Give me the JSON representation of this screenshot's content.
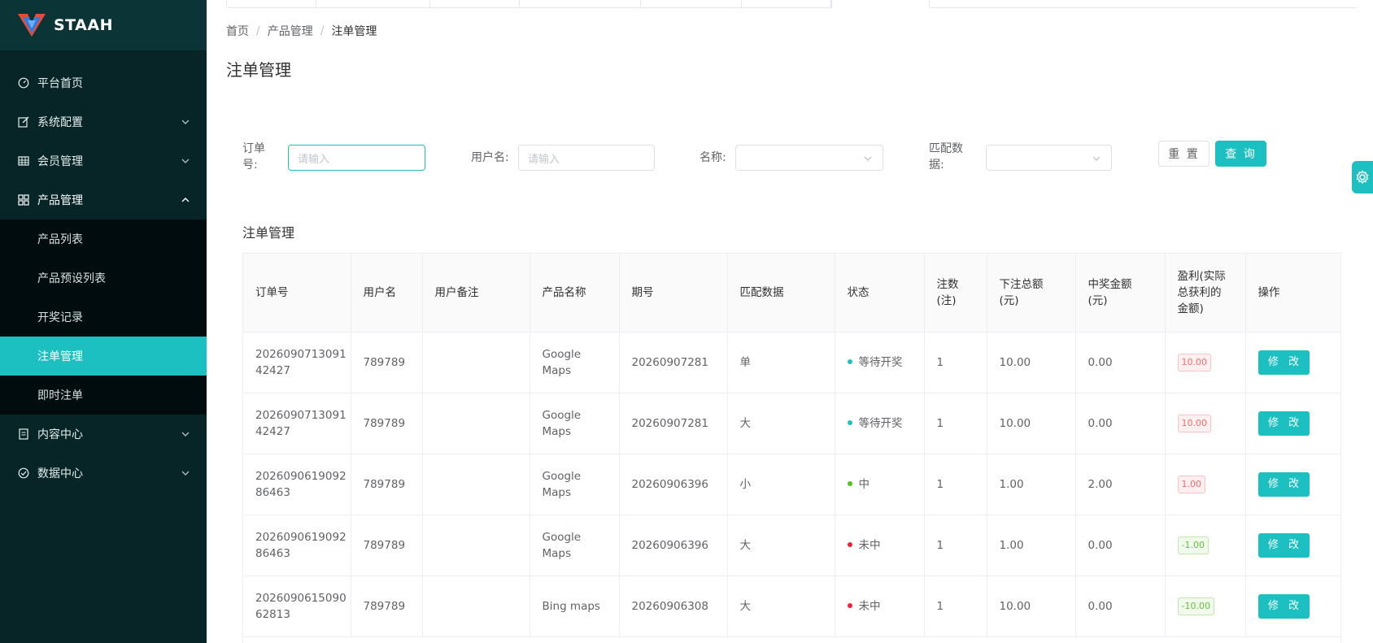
{
  "app": {
    "logo_text": "STAAH"
  },
  "sidebar": {
    "items": [
      {
        "label": "平台首页",
        "icon": "dashboard-icon"
      },
      {
        "label": "系统配置",
        "icon": "edit-icon"
      },
      {
        "label": "会员管理",
        "icon": "table-icon"
      },
      {
        "label": "产品管理",
        "icon": "grid-icon"
      },
      {
        "label": "内容中心",
        "icon": "document-icon"
      },
      {
        "label": "数据中心",
        "icon": "check-circle-icon"
      }
    ],
    "sub_items": [
      "产品列表",
      "产品预设列表",
      "开奖记录",
      "注单管理",
      "即时注单"
    ]
  },
  "breadcrumb": {
    "home": "首页",
    "level1": "产品管理",
    "current": "注单管理"
  },
  "page": {
    "title": "注单管理",
    "section_title": "注单管理"
  },
  "filters": {
    "order_label": "订单号:",
    "order_label_l1": "订单",
    "order_label_l2": "号:",
    "order_placeholder": "请输入",
    "username_label": "用户名:",
    "username_placeholder": "请输入",
    "name_label": "名称:",
    "match_label_l1": "匹配数",
    "match_label_l2": "据:",
    "reset_label": "重 置",
    "query_label": "查 询"
  },
  "table": {
    "headers": [
      [
        "订单号"
      ],
      [
        "用户名"
      ],
      [
        "用户备注"
      ],
      [
        "产品名称"
      ],
      [
        "期号"
      ],
      [
        "匹配数据"
      ],
      [
        "状态"
      ],
      [
        "注数",
        "(注)"
      ],
      [
        "下注总额",
        "(元)"
      ],
      [
        "中奖金额",
        "(元)"
      ],
      [
        "盈利(实际",
        "总获利的",
        "金额)"
      ],
      [
        "操作"
      ]
    ],
    "edit_label": "修 改",
    "rows": [
      {
        "order": [
          "2026090713091",
          "42427"
        ],
        "user": "789789",
        "note": "",
        "product": [
          "Google",
          "Maps"
        ],
        "period": "20260907281",
        "match": "单",
        "status": "等待开奖",
        "status_color": "#1cc0c0",
        "count": "1",
        "total": "10.00",
        "win": "0.00",
        "profit": "10.00",
        "profit_type": "red"
      },
      {
        "order": [
          "2026090713091",
          "42427"
        ],
        "user": "789789",
        "note": "",
        "product": [
          "Google",
          "Maps"
        ],
        "period": "20260907281",
        "match": "大",
        "status": "等待开奖",
        "status_color": "#1cc0c0",
        "count": "1",
        "total": "10.00",
        "win": "0.00",
        "profit": "10.00",
        "profit_type": "red"
      },
      {
        "order": [
          "2026090619092",
          "86463"
        ],
        "user": "789789",
        "note": "",
        "product": [
          "Google",
          "Maps"
        ],
        "period": "20260906396",
        "match": "小",
        "status": "中",
        "status_color": "#52c41a",
        "count": "1",
        "total": "1.00",
        "win": "2.00",
        "profit": "1.00",
        "profit_type": "red"
      },
      {
        "order": [
          "2026090619092",
          "86463"
        ],
        "user": "789789",
        "note": "",
        "product": [
          "Google",
          "Maps"
        ],
        "period": "20260906396",
        "match": "大",
        "status": "未中",
        "status_color": "#f5222d",
        "count": "1",
        "total": "1.00",
        "win": "0.00",
        "profit": "-1.00",
        "profit_type": "green"
      },
      {
        "order": [
          "2026090615090",
          "62813"
        ],
        "user": "789789",
        "note": "",
        "product": [
          "Bing maps"
        ],
        "period": "20260906308",
        "match": "大",
        "status": "未中",
        "status_color": "#f5222d",
        "count": "1",
        "total": "10.00",
        "win": "0.00",
        "profit": "-10.00",
        "profit_type": "green"
      }
    ]
  },
  "colors": {
    "accent": "#1cc0c0",
    "sidebar_bg": "#072527",
    "logo_bg": "#0b3436"
  }
}
